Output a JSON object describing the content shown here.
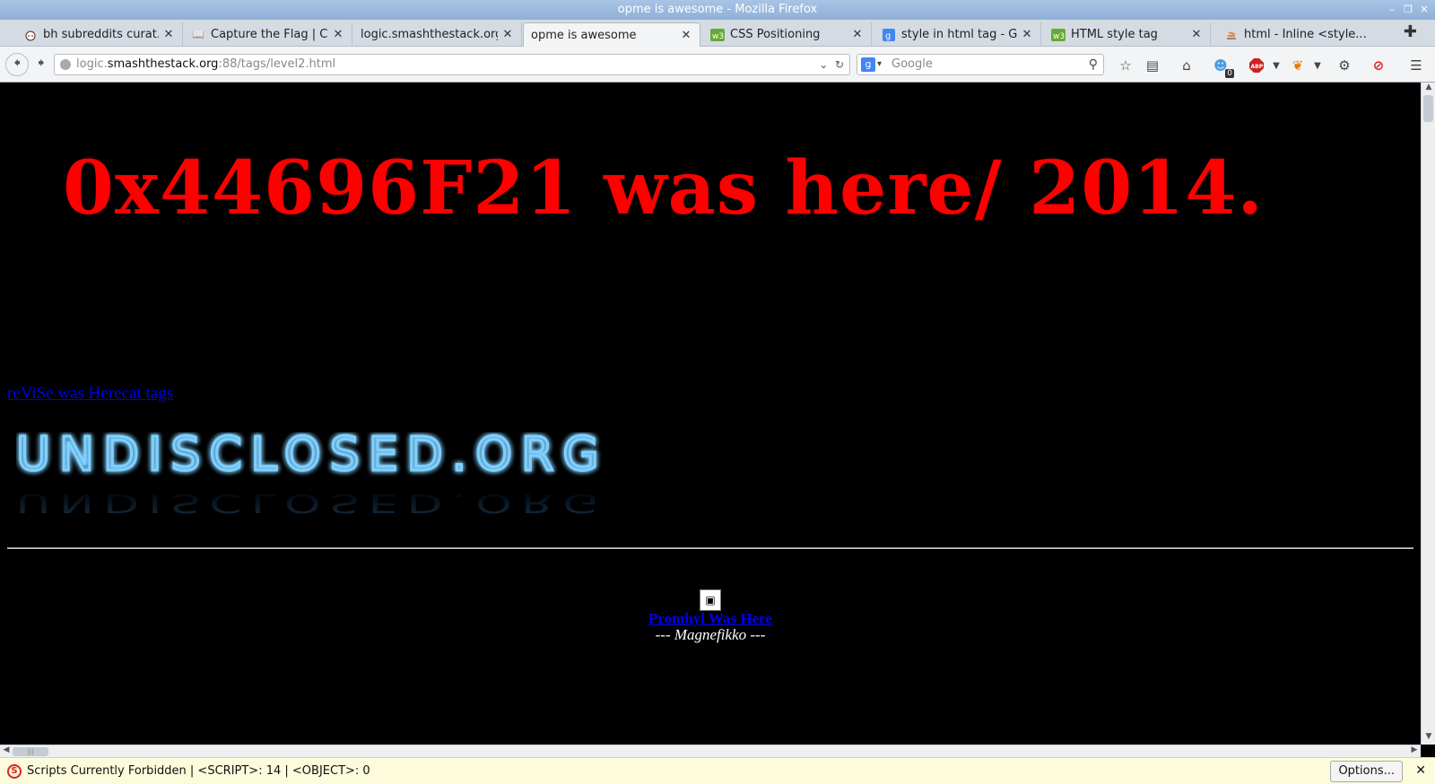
{
  "window": {
    "title": "opme is awesome - Mozilla Firefox"
  },
  "tabs": [
    {
      "label": "bh subreddits curat...",
      "icon": "reddit-icon"
    },
    {
      "label": "Capture the Flag | C...",
      "icon": "book-icon"
    },
    {
      "label": "logic.smashthestack.org",
      "icon": "none"
    },
    {
      "label": "opme is awesome",
      "icon": "none",
      "active": true
    },
    {
      "label": "CSS Positioning",
      "icon": "w3-icon"
    },
    {
      "label": "style in html tag - G...",
      "icon": "google-icon"
    },
    {
      "label": "HTML style tag",
      "icon": "w3-icon"
    },
    {
      "label": "html - Inline <style...",
      "icon": "stackoverflow-icon"
    }
  ],
  "nav": {
    "url_prefix": "logic.",
    "url_host": "smashthestack.org",
    "url_suffix": ":88/tags/level2.html",
    "search_placeholder": "Google",
    "badge_count": "0"
  },
  "page": {
    "headline": "0x44696F21 was here/ 2014.",
    "revise_link": "reViSe was Herecat tags",
    "logo_text": "UNDISCLOSED.ORG",
    "promhyl_link": "Promhyl Was Here",
    "signature": "--- Magnefikko ---"
  },
  "noscript": {
    "message": "Scripts Currently Forbidden | <SCRIPT>: 14 | <OBJECT>: 0",
    "options_label": "Options..."
  },
  "colors": {
    "headline": "#ff0000",
    "link": "#0000ee",
    "logo_glow": "#3fa9ff",
    "background": "#000000"
  }
}
